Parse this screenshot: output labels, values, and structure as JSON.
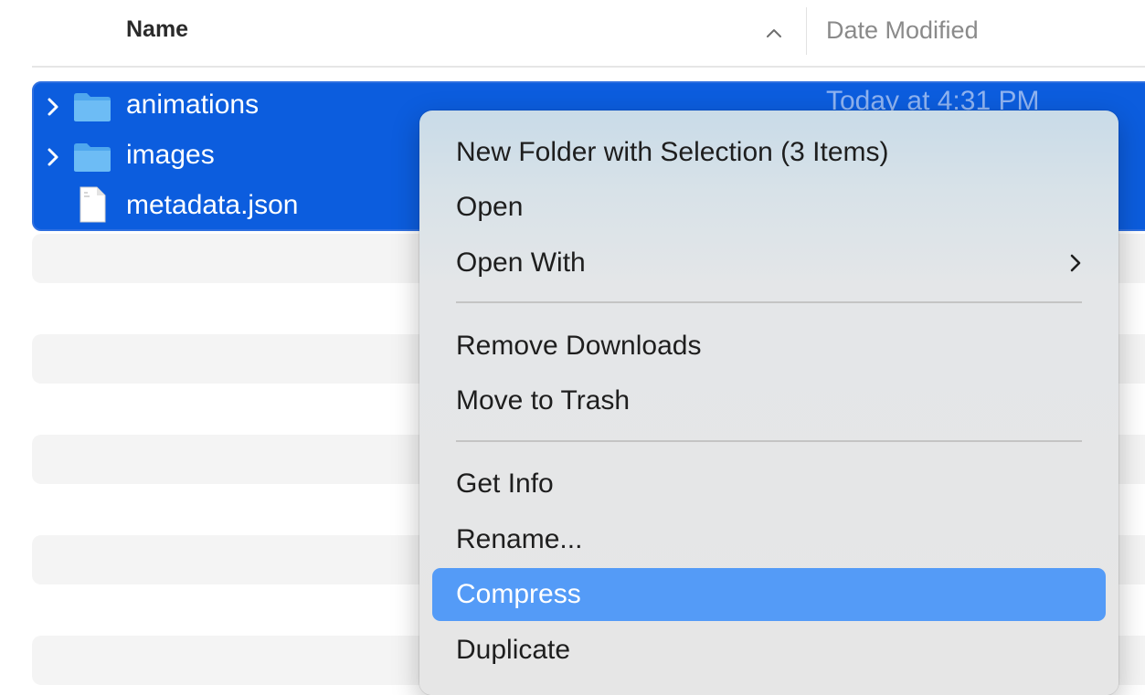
{
  "columns": {
    "name_label": "Name",
    "date_label": "Date Modified"
  },
  "files": [
    {
      "name": "animations",
      "kind": "folder",
      "date": "Today at 4:31 PM",
      "expandable": true
    },
    {
      "name": "images",
      "kind": "folder",
      "date": "",
      "expandable": true
    },
    {
      "name": "metadata.json",
      "kind": "document",
      "date": "",
      "expandable": false
    }
  ],
  "context_menu": {
    "items": [
      {
        "label": "New Folder with Selection (3 Items)"
      },
      {
        "label": "Open"
      },
      {
        "label": "Open With",
        "submenu": true
      },
      {
        "label": "Remove Downloads"
      },
      {
        "label": "Move to Trash"
      },
      {
        "label": "Get Info"
      },
      {
        "label": "Rename..."
      },
      {
        "label": "Compress",
        "highlighted": true
      },
      {
        "label": "Duplicate"
      }
    ]
  },
  "colors": {
    "selection": "#0c5dde",
    "menu_highlight": "#549bf7",
    "folder": "#5ab3f2"
  },
  "icons": {
    "sort": "chevron-up-icon",
    "disclosure": "chevron-right-icon",
    "folder": "folder-icon",
    "document": "document-icon",
    "submenu": "chevron-right-icon"
  }
}
